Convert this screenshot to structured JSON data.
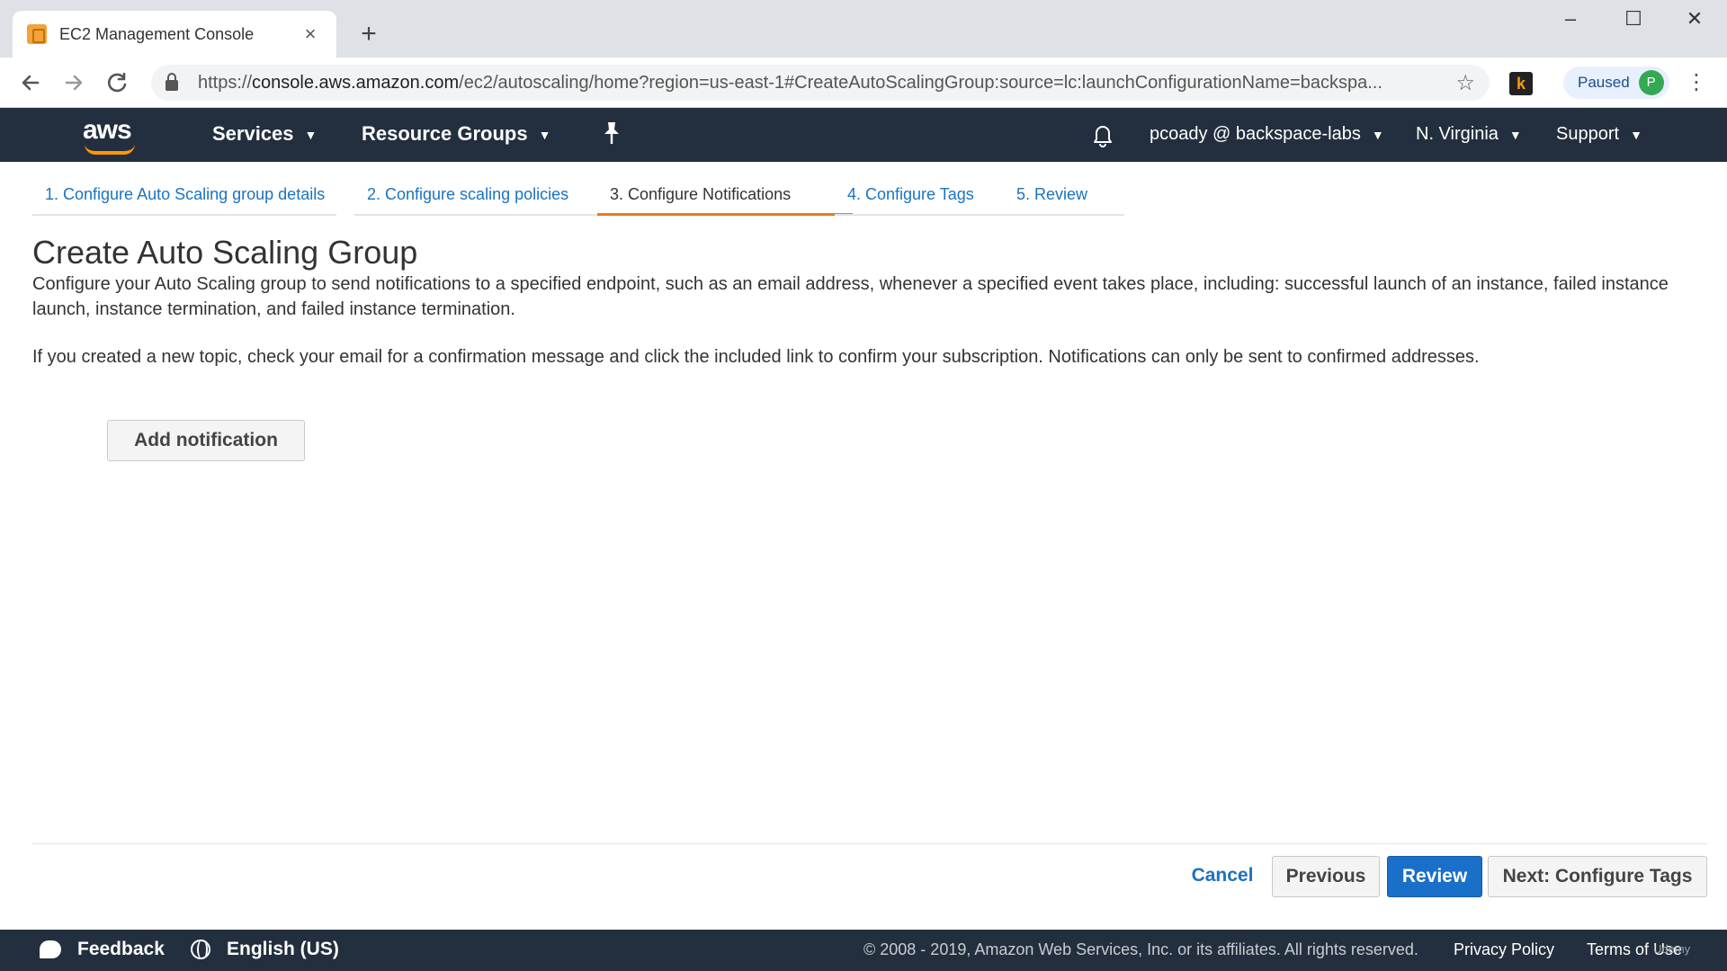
{
  "browser": {
    "tab_title": "EC2 Management Console",
    "tab_close": "×",
    "new_tab": "+",
    "url_prefix": "https://",
    "url_host": "console.aws.amazon.com",
    "url_rest": "/ec2/autoscaling/home?region=us-east-1#CreateAutoScalingGroup:source=lc:launchConfigurationName=backspa...",
    "extension_letter": "k",
    "paused_label": "Paused",
    "profile_initial": "P",
    "minimize": "–",
    "maximize": "☐",
    "close": "✕"
  },
  "aws_nav": {
    "logo": "aws",
    "services": "Services",
    "resource_groups": "Resource Groups",
    "account": "pcoady @ backspace-labs",
    "region": "N. Virginia",
    "support": "Support",
    "chevron": "⌄"
  },
  "wizard": {
    "steps": [
      {
        "label": "1. Configure Auto Scaling group details"
      },
      {
        "label": "2. Configure scaling policies"
      },
      {
        "label": "3. Configure Notifications"
      },
      {
        "label": "4. Configure Tags"
      },
      {
        "label": "5. Review"
      }
    ],
    "active_step": 3
  },
  "main": {
    "title": "Create Auto Scaling Group",
    "description": "Configure your Auto Scaling group to send notifications to a specified endpoint, such as an email address, whenever a specified event takes place, including: successful launch of an instance, failed instance launch, instance termination, and failed instance termination.",
    "confirmation_note": "If you created a new topic, check your email for a confirmation message and click the included link to confirm your subscription. Notifications can only be sent to confirmed addresses.",
    "add_notification_label": "Add notification"
  },
  "actions": {
    "cancel": "Cancel",
    "previous": "Previous",
    "review": "Review",
    "next": "Next: Configure Tags"
  },
  "footer": {
    "feedback": "Feedback",
    "language": "English (US)",
    "copyright": "© 2008 - 2019, Amazon Web Services, Inc. or its affiliates. All rights reserved.",
    "privacy": "Privacy Policy",
    "terms": "Terms of Use",
    "watermark": "Udemy"
  },
  "colors": {
    "aws_nav_bg": "#232f3e",
    "aws_orange": "#ff9900",
    "link_blue": "#1a73c0",
    "primary_button": "#1a6fc9",
    "active_step_underline": "#e97a1f"
  }
}
